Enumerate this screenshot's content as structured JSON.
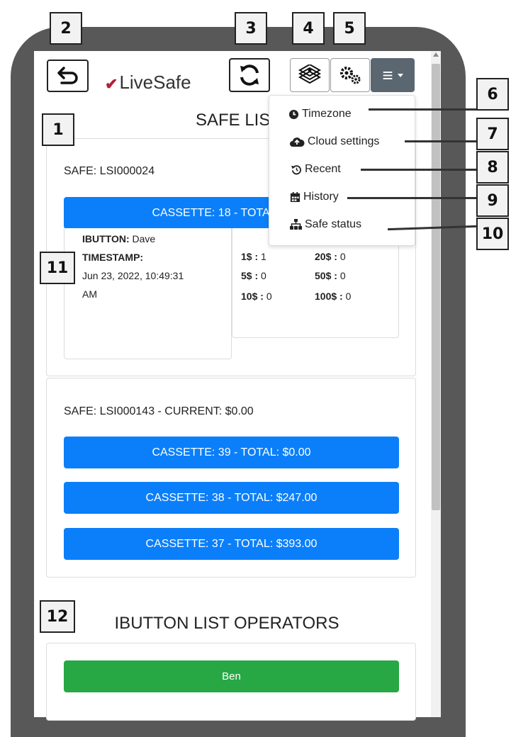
{
  "header": {
    "logo_text": "LiveSafe",
    "logo_mark": "✔",
    "menu_glyph": "≡"
  },
  "safe_list": {
    "title": "SAFE LIST",
    "safes": [
      {
        "label": "SAFE: LSI000024",
        "cassette": "CASSETTE: 18 - TOTAL: $1.00",
        "detail": {
          "ibutton_label": "IBUTTON:",
          "ibutton_value": "Dave",
          "timestamp_label": "TIMESTAMP:",
          "timestamp_line1": "Jun 23, 2022, 10:49:31",
          "timestamp_line2": "AM"
        },
        "denominations": [
          {
            "label": "1$ :",
            "count": "1"
          },
          {
            "label": "20$ :",
            "count": "0"
          },
          {
            "label": "5$ :",
            "count": "0"
          },
          {
            "label": "50$ :",
            "count": "0"
          },
          {
            "label": "10$ :",
            "count": "0"
          },
          {
            "label": "100$ :",
            "count": "0"
          }
        ]
      },
      {
        "label": "SAFE: LSI000143 - CURRENT: $0.00",
        "cassettes": [
          "CASSETTE: 39 - TOTAL: $0.00",
          "CASSETTE: 38 - TOTAL: $247.00",
          "CASSETTE: 37 - TOTAL: $393.00"
        ]
      }
    ]
  },
  "operators": {
    "title": "IBUTTON LIST OPERATORS",
    "items": [
      "Ben"
    ]
  },
  "menu": {
    "items": [
      {
        "label": "Timezone",
        "icon": "clock-icon"
      },
      {
        "label": "Cloud settings",
        "icon": "cloud-upload-icon"
      },
      {
        "label": "Recent",
        "icon": "history-icon"
      },
      {
        "label": "History",
        "icon": "calendar-icon"
      },
      {
        "label": "Safe status",
        "icon": "sitemap-icon"
      }
    ]
  },
  "callouts": [
    "1",
    "2",
    "3",
    "4",
    "5",
    "6",
    "7",
    "8",
    "9",
    "10",
    "11",
    "12"
  ]
}
